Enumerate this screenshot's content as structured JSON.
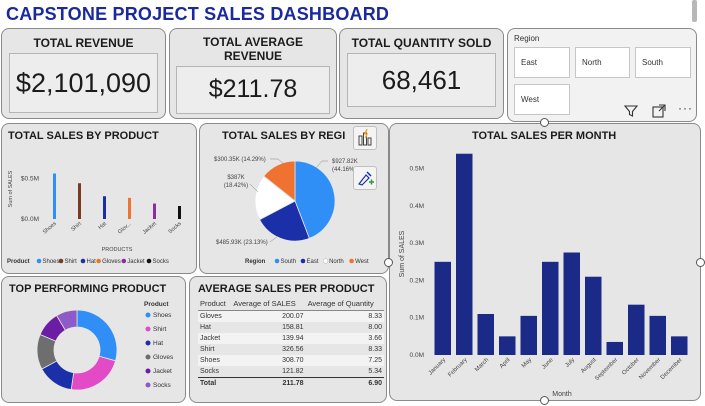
{
  "title": "CAPSTONE PROJECT SALES DASHBOARD",
  "kpis": {
    "total_revenue_label": "TOTAL REVENUE",
    "total_revenue_value": "$2,101,090",
    "avg_revenue_label": "TOTAL AVERAGE REVENUE",
    "avg_revenue_value": "$211.78",
    "qty_label": "TOTAL QUANTITY SOLD",
    "qty_value": "68,461"
  },
  "region_slicer": {
    "label": "Region",
    "options": [
      "East",
      "North",
      "South",
      "West"
    ]
  },
  "toolbar": {
    "icons": [
      "filter-icon",
      "focus-mode-icon",
      "more-options-icon"
    ],
    "more_label": "···"
  },
  "side_icons": [
    "visual-insights-icon",
    "format-brush-icon"
  ],
  "colors": {
    "Shoes": "#2f8ff7",
    "Shirt": "#e24ac6",
    "Hat": "#1b2fa8",
    "Gloves": "#6e6e6e",
    "Jacket": "#6b1ea4",
    "Socks": "#8e5ac8",
    "bar_dark": "#1b2a87",
    "South": "#2f8ff7",
    "East": "#1b2fa8",
    "North": "#ffffff",
    "West": "#f07230"
  },
  "chart_data": [
    {
      "id": "sales_by_product",
      "type": "bar",
      "title": "TOTAL SALES BY PRODUCT",
      "xlabel": "PRODUCTS",
      "ylabel": "Sum of SALES",
      "yticks": [
        "$0.0M",
        "$0.5M"
      ],
      "ylim": [
        0,
        0.8
      ],
      "categories": [
        "Shoes",
        "Shirt",
        "Hat",
        "Glov...",
        "Jacket",
        "Socks"
      ],
      "values": [
        0.56,
        0.44,
        0.28,
        0.26,
        0.19,
        0.16
      ],
      "bar_colors": [
        "#2f8ff7",
        "#7a3a22",
        "#1b2fa8",
        "#f07230",
        "#8a2fa0",
        "#111111"
      ],
      "legend_title": "Product",
      "legend": [
        "Shoes",
        "Shirt",
        "Hat",
        "Gloves",
        "Jacket",
        "Socks"
      ],
      "legend_colors": [
        "#2f8ff7",
        "#7a3a22",
        "#1b2fa8",
        "#f07230",
        "#8a2fa0",
        "#111111"
      ]
    },
    {
      "id": "sales_by_region",
      "type": "pie",
      "title": "TOTAL SALES BY REGION",
      "title_visible": "TOTAL SALES BY REGI",
      "slices": [
        {
          "name": "South",
          "value": 927.82,
          "label": "$927.82K",
          "pct": "(44.16%)",
          "color": "#2f8ff7"
        },
        {
          "name": "East",
          "value": 485.93,
          "label": "$485.93K (23.13%)",
          "color": "#1b2fa8"
        },
        {
          "name": "North",
          "value": 387,
          "label": "$387K",
          "pct": "(18.42%)",
          "color": "#ffffff"
        },
        {
          "name": "West",
          "value": 300.35,
          "label": "$300.35K (14.29%)",
          "color": "#f07230"
        }
      ],
      "legend_title": "Region",
      "legend": [
        "South",
        "East",
        "North",
        "West"
      ]
    },
    {
      "id": "sales_per_month",
      "type": "bar",
      "title": "TOTAL SALES PER MONTH",
      "xlabel": "Month",
      "ylabel": "Sum of SALES",
      "yticks": [
        "0.0M",
        "0.1M",
        "0.2M",
        "0.3M",
        "0.4M",
        "0.5M"
      ],
      "ylim": [
        0,
        0.55
      ],
      "categories": [
        "January",
        "February",
        "March",
        "April",
        "May",
        "June",
        "July",
        "August",
        "September",
        "October",
        "November",
        "December"
      ],
      "values": [
        0.25,
        0.54,
        0.11,
        0.05,
        0.105,
        0.25,
        0.275,
        0.21,
        0.035,
        0.135,
        0.105,
        0.05
      ]
    },
    {
      "id": "top_performing_product",
      "type": "pie",
      "subtype": "donut",
      "title": "TOP PERFORMING PRODUCT",
      "legend_title": "Product",
      "slices": [
        {
          "name": "Shoes",
          "value": 26.6,
          "color": "#2f8ff7"
        },
        {
          "name": "Shirt",
          "value": 20.8,
          "color": "#e24ac6"
        },
        {
          "name": "Hat",
          "value": 13.4,
          "color": "#1b2fa8"
        },
        {
          "name": "Gloves",
          "value": 12.9,
          "color": "#6e6e6e"
        },
        {
          "name": "Jacket",
          "value": 9.2,
          "color": "#6b1ea4"
        },
        {
          "name": "Socks",
          "value": 7.7,
          "color": "#8e5ac8"
        }
      ]
    },
    {
      "id": "avg_sales_per_product",
      "type": "table",
      "title": "AVERAGE SALES PER PRODUCT",
      "columns": [
        "Product",
        "Average of SALES",
        "Average of Quantity"
      ],
      "rows": [
        [
          "Gloves",
          "200.07",
          "8.33"
        ],
        [
          "Hat",
          "158.81",
          "8.00"
        ],
        [
          "Jacket",
          "139.94",
          "3.66"
        ],
        [
          "Shirt",
          "326.56",
          "8.33"
        ],
        [
          "Shoes",
          "308.70",
          "7.25"
        ],
        [
          "Socks",
          "121.82",
          "5.34"
        ]
      ],
      "total": [
        "Total",
        "211.78",
        "6.90"
      ]
    }
  ]
}
